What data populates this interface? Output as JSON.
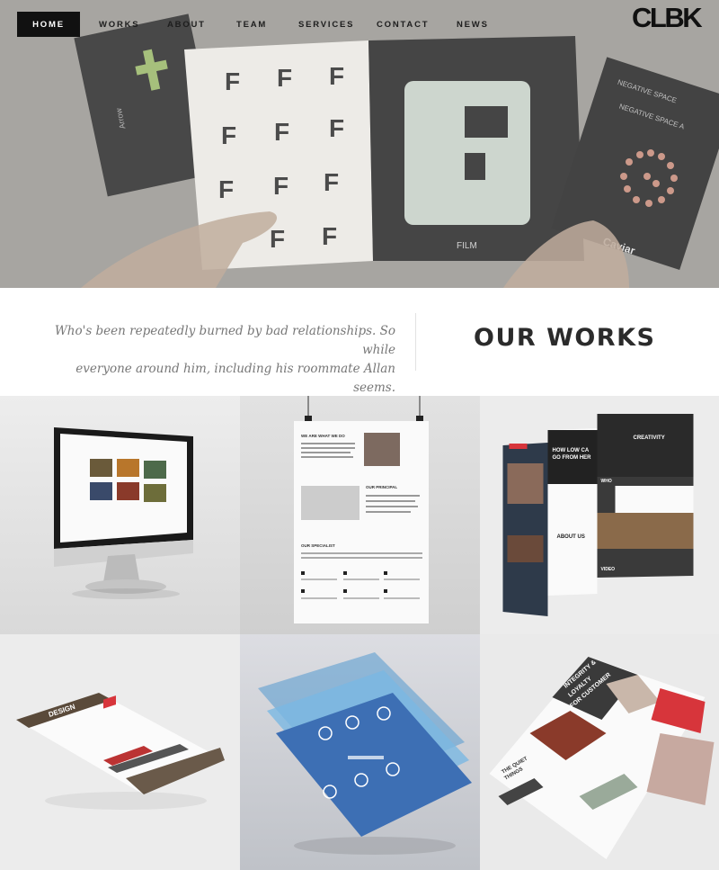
{
  "nav": {
    "items": [
      {
        "label": "HOME",
        "active": true
      },
      {
        "label": "WORKS"
      },
      {
        "label": "ABOUT"
      },
      {
        "label": "TEAM"
      },
      {
        "label": "SERVICES"
      },
      {
        "label": "CONTACT"
      },
      {
        "label": "NEWS"
      }
    ]
  },
  "brand": {
    "logo": "CLBK"
  },
  "hero": {
    "card_arrow": "Arrow",
    "card_negative_1": "NEGATIVE SPACE",
    "card_negative_2": "NEGATIVE SPACE A",
    "film_label": "FILM",
    "caviar_label": "Caviar"
  },
  "intro": {
    "quote_line1": "Who's been repeatedly burned by bad relationships. So while",
    "quote_line2": "everyone around him, including his roommate Allan seems.",
    "title": "OUR WORKS"
  },
  "works": {
    "poster_heading_1": "WE ARE WHAT WE DO",
    "poster_heading_2": "OUR PRINCIPAL",
    "poster_heading_3": "OUR SPECIALIST",
    "mobile_how": "HOW LOW CA",
    "mobile_go": "GO FROM HER",
    "mobile_about": "ABOUT US",
    "mobile_creativity": "CREATIVITY",
    "mobile_who": "WHO",
    "mobile_video": "VIDEO",
    "tablet_design": "DESIGN",
    "magazine_integrity": "INTEGRITY &",
    "magazine_loyalty": "LOYALTY",
    "magazine_customer": "FOR CUSTOMER",
    "magazine_quiet": "THE QUIET",
    "magazine_things": "THINGS"
  },
  "colors": {
    "nav_active_bg": "#111111",
    "accent_red": "#d7353b",
    "text_dark": "#2b2b2b"
  }
}
